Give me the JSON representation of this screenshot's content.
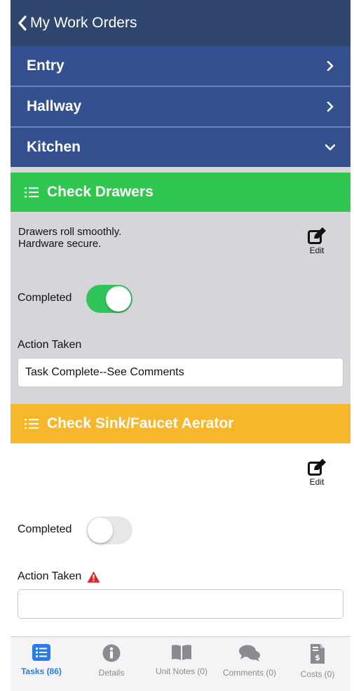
{
  "navbar": {
    "back_label": "My Work Orders"
  },
  "sections": [
    {
      "label": "Entry",
      "state": "collapsed"
    },
    {
      "label": "Hallway",
      "state": "collapsed"
    },
    {
      "label": "Kitchen",
      "state": "expanded"
    }
  ],
  "tasks": [
    {
      "title": "Check Drawers",
      "header_color": "#2fc74f",
      "description_lines": [
        "Drawers roll smoothly.",
        "Hardware secure."
      ],
      "edit_label": "Edit",
      "completed_label": "Completed",
      "completed": true,
      "action_label": "Action Taken",
      "action_value": "Task Complete--See Comments"
    },
    {
      "title": "Check Sink/Faucet Aerator",
      "header_color": "#f6b72d",
      "edit_label": "Edit",
      "completed_label": "Completed",
      "completed": false,
      "action_label": "Action Taken",
      "action_required_icon": "warning-icon",
      "action_value": ""
    }
  ],
  "tabbar": {
    "active": "tasks",
    "items": [
      {
        "id": "tasks",
        "label": "Tasks (86)",
        "icon": "list-icon"
      },
      {
        "id": "details",
        "label": "Details",
        "icon": "info-icon"
      },
      {
        "id": "unit-notes",
        "label": "Unit Notes (0)",
        "icon": "book-icon"
      },
      {
        "id": "comments",
        "label": "Comments (0)",
        "icon": "chat-bubbles-icon"
      },
      {
        "id": "costs",
        "label": "Costs (0)",
        "icon": "invoice-icon"
      }
    ]
  },
  "colors": {
    "navbar": "#2f466e",
    "section_row": "#34508f",
    "completed_task": "#2fc74f",
    "pending_task": "#f6b72d",
    "toggle_on": "#2fc55a",
    "active_tab": "#2a7bea",
    "warning": "#e0252b"
  }
}
